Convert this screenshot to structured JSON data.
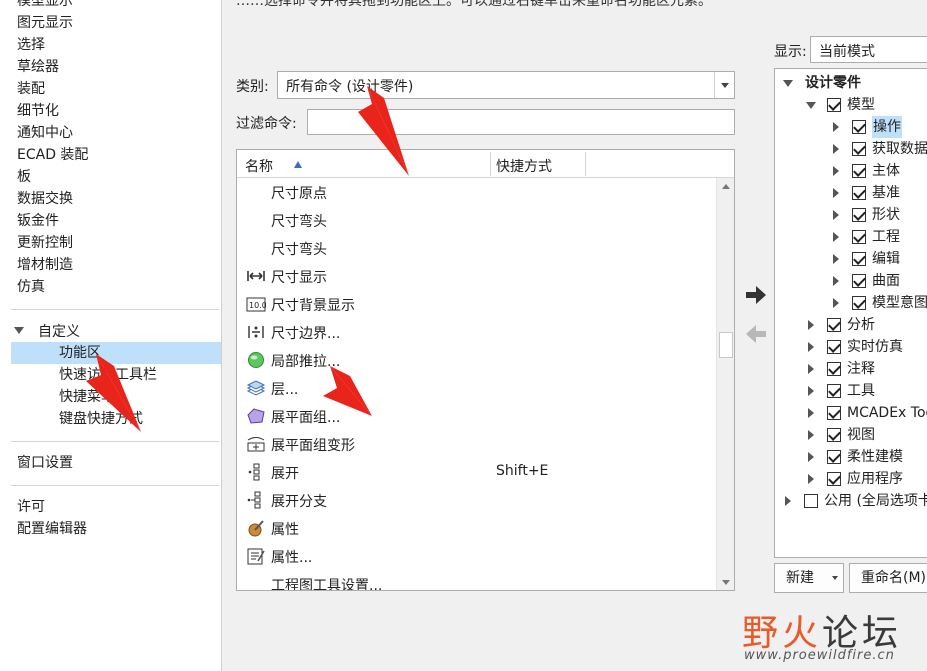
{
  "top_text": "……选择命令并将其拖到功能区上。可以通过右键单击来重命名功能区元素。",
  "left_nav": {
    "items_top": [
      "模型显示",
      "图元显示",
      "选择",
      "草绘器",
      "装配",
      "细节化",
      "通知中心",
      "ECAD 装配",
      "板",
      "数据交换",
      "钣金件",
      "更新控制",
      "增材制造",
      "仿真"
    ],
    "customize_label": "自定义",
    "customize_children": [
      "功能区",
      "快速访问工具栏",
      "快捷菜单",
      "键盘快捷方式"
    ],
    "window_settings": "窗口设置",
    "license": "许可",
    "config_editor": "配置编辑器"
  },
  "category": {
    "label": "类别:",
    "value": "所有命令 (设计零件)"
  },
  "filter": {
    "label": "过滤命令:",
    "value": ""
  },
  "command_list": {
    "col_name": "名称",
    "col_shortcut": "快捷方式",
    "rows": [
      {
        "name": "尺寸原点",
        "shortcut": "",
        "icon": "none"
      },
      {
        "name": "尺寸弯头",
        "shortcut": "",
        "icon": "none"
      },
      {
        "name": "尺寸弯头",
        "shortcut": "",
        "icon": "none"
      },
      {
        "name": "尺寸显示",
        "shortcut": "",
        "icon": "dimension-display-icon"
      },
      {
        "name": "尺寸背景显示",
        "shortcut": "",
        "icon": "dimension-background-icon"
      },
      {
        "name": "尺寸边界...",
        "shortcut": "",
        "icon": "dimension-boundary-icon"
      },
      {
        "name": "局部推拉...",
        "shortcut": "",
        "icon": "local-push-icon"
      },
      {
        "name": "层...",
        "shortcut": "",
        "icon": "layer-icon"
      },
      {
        "name": "展平面组...",
        "shortcut": "",
        "icon": "flatten-quilt-icon"
      },
      {
        "name": "展平面组变形",
        "shortcut": "",
        "icon": "flatten-quilt-deform-icon"
      },
      {
        "name": "展开",
        "shortcut": "Shift+E",
        "icon": "explode-icon"
      },
      {
        "name": "展开分支",
        "shortcut": "",
        "icon": "explode-branch-icon"
      },
      {
        "name": "属性",
        "shortcut": "",
        "icon": "properties-icon"
      },
      {
        "name": "属性...",
        "shortcut": "",
        "icon": "properties-dialog-icon"
      },
      {
        "name": "工程图工具设置...",
        "shortcut": "",
        "icon": "none"
      }
    ]
  },
  "display": {
    "label": "显示:",
    "value": "当前模式"
  },
  "ribbon_tree": [
    {
      "label": "设计零件",
      "level": 0,
      "expanded": true,
      "checkbox": false,
      "bold": true
    },
    {
      "label": "模型",
      "level": 1,
      "expanded": true,
      "checkbox": true
    },
    {
      "label": "操作",
      "level": 2,
      "expanded": false,
      "checkbox": true,
      "selected": true
    },
    {
      "label": "获取数据",
      "level": 2,
      "expanded": false,
      "checkbox": true
    },
    {
      "label": "主体",
      "level": 2,
      "expanded": false,
      "checkbox": true
    },
    {
      "label": "基准",
      "level": 2,
      "expanded": false,
      "checkbox": true
    },
    {
      "label": "形状",
      "level": 2,
      "expanded": false,
      "checkbox": true
    },
    {
      "label": "工程",
      "level": 2,
      "expanded": false,
      "checkbox": true
    },
    {
      "label": "编辑",
      "level": 2,
      "expanded": false,
      "checkbox": true
    },
    {
      "label": "曲面",
      "level": 2,
      "expanded": false,
      "checkbox": true
    },
    {
      "label": "模型意图",
      "level": 2,
      "expanded": false,
      "checkbox": true
    },
    {
      "label": "分析",
      "level": 1,
      "expanded": false,
      "checkbox": true
    },
    {
      "label": "实时仿真",
      "level": 1,
      "expanded": false,
      "checkbox": true
    },
    {
      "label": "注释",
      "level": 1,
      "expanded": false,
      "checkbox": true
    },
    {
      "label": "工具",
      "level": 1,
      "expanded": false,
      "checkbox": true
    },
    {
      "label": "MCADEx Tools",
      "level": 1,
      "expanded": false,
      "checkbox": true
    },
    {
      "label": "视图",
      "level": 1,
      "expanded": false,
      "checkbox": true
    },
    {
      "label": "柔性建模",
      "level": 1,
      "expanded": false,
      "checkbox": true
    },
    {
      "label": "应用程序",
      "level": 1,
      "expanded": false,
      "checkbox": true
    },
    {
      "label": "公用 (全局选项卡)",
      "level": 0,
      "expanded": false,
      "checkbox": true,
      "checked": false
    }
  ],
  "buttons": {
    "new": "新建",
    "rename": "重命名(M)"
  },
  "watermark": {
    "part1": "野火",
    "part2": "论坛",
    "url": "www.proewildfire.cn"
  },
  "colors": {
    "selection": "#bfe0fa",
    "annotation": "#e8241b"
  }
}
